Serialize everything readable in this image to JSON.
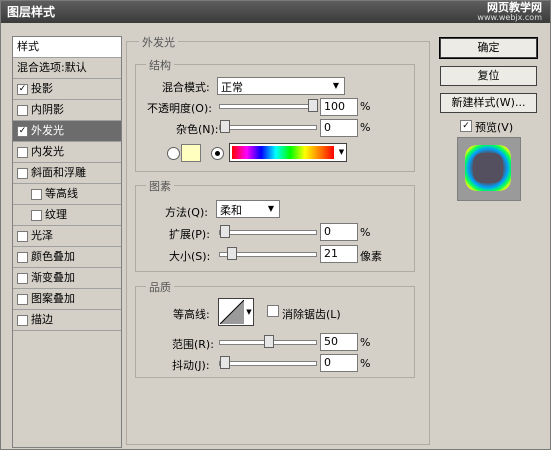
{
  "window": {
    "title": "图层样式"
  },
  "watermark": {
    "line1": "网页教学网",
    "line2": "www.webjx.com"
  },
  "sidebar": {
    "header": "样式",
    "items": [
      {
        "label": "混合选项:默认",
        "checkbox": false,
        "checked": false,
        "indent": 0,
        "selected": false
      },
      {
        "label": "投影",
        "checkbox": true,
        "checked": true,
        "indent": 0,
        "selected": false
      },
      {
        "label": "内阴影",
        "checkbox": true,
        "checked": false,
        "indent": 0,
        "selected": false
      },
      {
        "label": "外发光",
        "checkbox": true,
        "checked": true,
        "indent": 0,
        "selected": true
      },
      {
        "label": "内发光",
        "checkbox": true,
        "checked": false,
        "indent": 0,
        "selected": false
      },
      {
        "label": "斜面和浮雕",
        "checkbox": true,
        "checked": false,
        "indent": 0,
        "selected": false
      },
      {
        "label": "等高线",
        "checkbox": true,
        "checked": false,
        "indent": 1,
        "selected": false
      },
      {
        "label": "纹理",
        "checkbox": true,
        "checked": false,
        "indent": 1,
        "selected": false
      },
      {
        "label": "光泽",
        "checkbox": true,
        "checked": false,
        "indent": 0,
        "selected": false
      },
      {
        "label": "颜色叠加",
        "checkbox": true,
        "checked": false,
        "indent": 0,
        "selected": false
      },
      {
        "label": "渐变叠加",
        "checkbox": true,
        "checked": false,
        "indent": 0,
        "selected": false
      },
      {
        "label": "图案叠加",
        "checkbox": true,
        "checked": false,
        "indent": 0,
        "selected": false
      },
      {
        "label": "描边",
        "checkbox": true,
        "checked": false,
        "indent": 0,
        "selected": false
      }
    ]
  },
  "outer_glow": {
    "title": "外发光",
    "structure": {
      "title": "结构",
      "blend_mode_label": "混合模式:",
      "blend_mode_value": "正常",
      "opacity_label": "不透明度(O):",
      "opacity_value": "100",
      "opacity_unit": "%",
      "opacity_level": 1.0,
      "noise_label": "杂色(N):",
      "noise_value": "0",
      "noise_unit": "%",
      "noise_level": 0.0,
      "swatch_color": "#ffffc0"
    },
    "elements": {
      "title": "图素",
      "technique_label": "方法(Q):",
      "technique_value": "柔和",
      "spread_label": "扩展(P):",
      "spread_value": "0",
      "spread_unit": "%",
      "spread_level": 0.0,
      "size_label": "大小(S):",
      "size_value": "21",
      "size_unit": "像素",
      "size_level": 0.08
    },
    "quality": {
      "title": "品质",
      "contour_label": "等高线:",
      "antialias_label": "消除锯齿(L)",
      "range_label": "范围(R):",
      "range_value": "50",
      "range_unit": "%",
      "range_level": 0.5,
      "jitter_label": "抖动(J):",
      "jitter_value": "0",
      "jitter_unit": "%",
      "jitter_level": 0.0
    }
  },
  "buttons": {
    "ok": "确定",
    "reset": "复位",
    "new_style": "新建样式(W)...",
    "preview": "预览(V)"
  }
}
